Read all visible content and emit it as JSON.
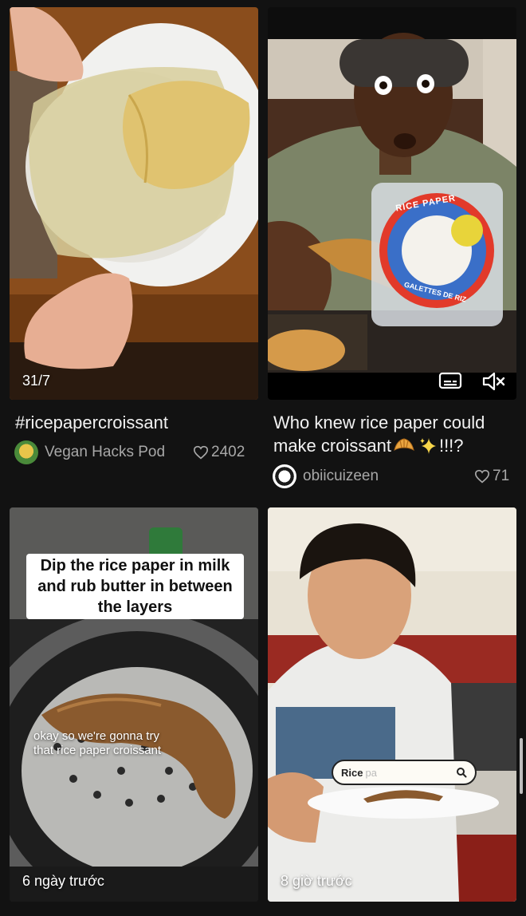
{
  "cards": [
    {
      "timestamp": "31/7",
      "title": "#ricepapercroissant",
      "author": "Vegan Hacks Pod",
      "likes": "2402"
    },
    {
      "title_line1": "Who knew rice paper could",
      "title_line2_text": "make croissant",
      "title_line2_tail": " !!!?",
      "author": "obiicuizeen",
      "likes": "71",
      "bag_label": "RICE PAPER",
      "bag_sub": "GALETTES DE RIZ"
    },
    {
      "caption_line1": "Dip the rice paper in milk",
      "caption_line2": "and rub butter in between",
      "caption_line3": "the layers",
      "subtitle_line1": "okay so we're gonna try",
      "subtitle_line2": "that rice paper croissant",
      "timestamp": "6 ngày trước"
    },
    {
      "search_text": "Rice",
      "search_ghost": "pa",
      "timestamp": "8 giờ trước"
    }
  ],
  "icons": [
    "captions-icon",
    "mute-icon",
    "heart-icon",
    "search-icon",
    "croissant-emoji",
    "sparkles-emoji"
  ]
}
